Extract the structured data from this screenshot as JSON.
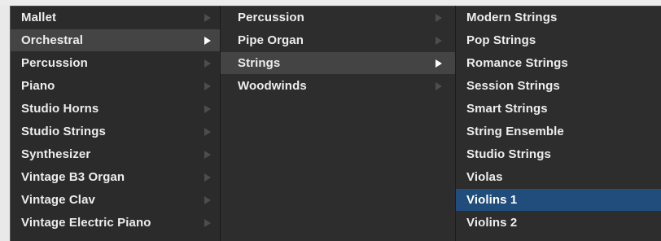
{
  "colors": {
    "menu_bg": "#2b2b2b",
    "highlight_bg": "#444444",
    "selected_bg": "#214d7d",
    "text": "#ededed",
    "submenu_arrow": "#4d4d4d",
    "submenu_arrow_active": "#ffffff"
  },
  "icons": {
    "submenu_arrow": "triangle-right-icon"
  },
  "menu_level_1": {
    "items": [
      {
        "label": "Mallet",
        "has_submenu": true
      },
      {
        "label": "Orchestral",
        "has_submenu": true,
        "state": "open"
      },
      {
        "label": "Percussion",
        "has_submenu": true
      },
      {
        "label": "Piano",
        "has_submenu": true
      },
      {
        "label": "Studio Horns",
        "has_submenu": true
      },
      {
        "label": "Studio Strings",
        "has_submenu": true
      },
      {
        "label": "Synthesizer",
        "has_submenu": true
      },
      {
        "label": "Vintage B3 Organ",
        "has_submenu": true
      },
      {
        "label": "Vintage Clav",
        "has_submenu": true
      },
      {
        "label": "Vintage Electric Piano",
        "has_submenu": true
      }
    ]
  },
  "menu_level_2": {
    "items": [
      {
        "label": "Percussion",
        "has_submenu": true
      },
      {
        "label": "Pipe Organ",
        "has_submenu": true
      },
      {
        "label": "Strings",
        "has_submenu": true,
        "state": "open"
      },
      {
        "label": "Woodwinds",
        "has_submenu": true
      }
    ]
  },
  "menu_level_3": {
    "items": [
      {
        "label": "Modern Strings"
      },
      {
        "label": "Pop Strings"
      },
      {
        "label": "Romance Strings"
      },
      {
        "label": "Session Strings"
      },
      {
        "label": "Smart Strings"
      },
      {
        "label": "String Ensemble"
      },
      {
        "label": "Studio Strings"
      },
      {
        "label": "Violas"
      },
      {
        "label": "Violins 1",
        "state": "selected"
      },
      {
        "label": "Violins 2"
      }
    ]
  }
}
